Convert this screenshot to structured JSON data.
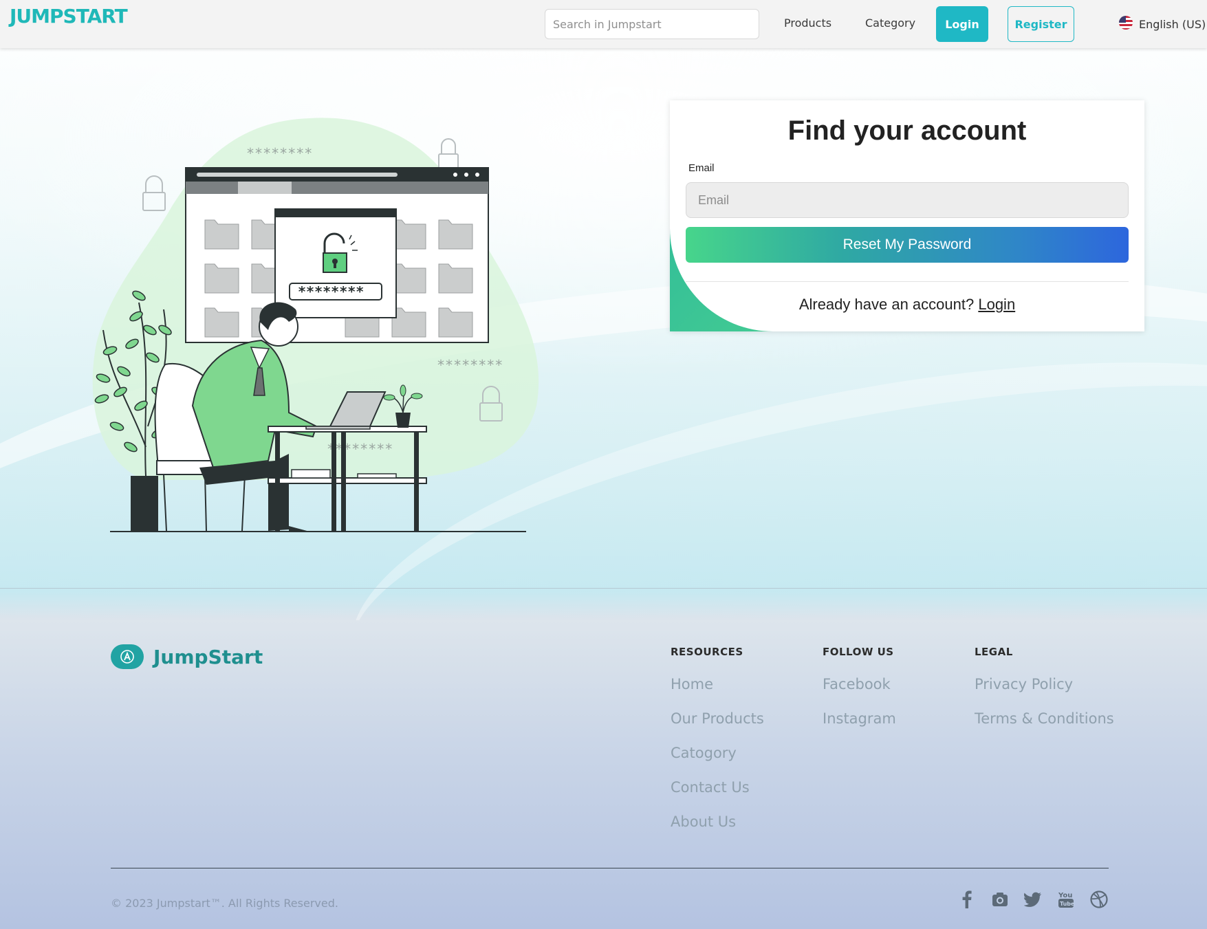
{
  "header": {
    "brand": "JUMPSTART",
    "search_placeholder": "Search in Jumpstart",
    "nav": [
      "Products",
      "Category"
    ],
    "login_label": "Login",
    "register_label": "Register",
    "language": "English (US)",
    "accent_color": "#1fb8c5"
  },
  "illustration": {
    "password_mask": "********"
  },
  "card": {
    "title": "Find your account",
    "email_label": "Email",
    "email_placeholder": "Email",
    "email_value": "",
    "reset_label": "Reset My Password",
    "already_text": "Already have an account?",
    "login_link": "Login"
  },
  "footer": {
    "brand": "JumpStart",
    "columns": [
      {
        "heading": "RESOURCES",
        "links": [
          "Home",
          "Our Products",
          "Catogory",
          "Contact Us",
          "About Us"
        ]
      },
      {
        "heading": "FOLLOW US",
        "links": [
          "Facebook",
          "Instagram"
        ]
      },
      {
        "heading": "LEGAL",
        "links": [
          "Privacy Policy",
          "Terms & Conditions"
        ]
      }
    ],
    "copyright": "© 2023 Jumpstart™. All Rights Reserved.",
    "social_icons": [
      "facebook-icon",
      "instagram-icon",
      "twitter-icon",
      "youtube-icon",
      "dribbble-icon"
    ]
  }
}
